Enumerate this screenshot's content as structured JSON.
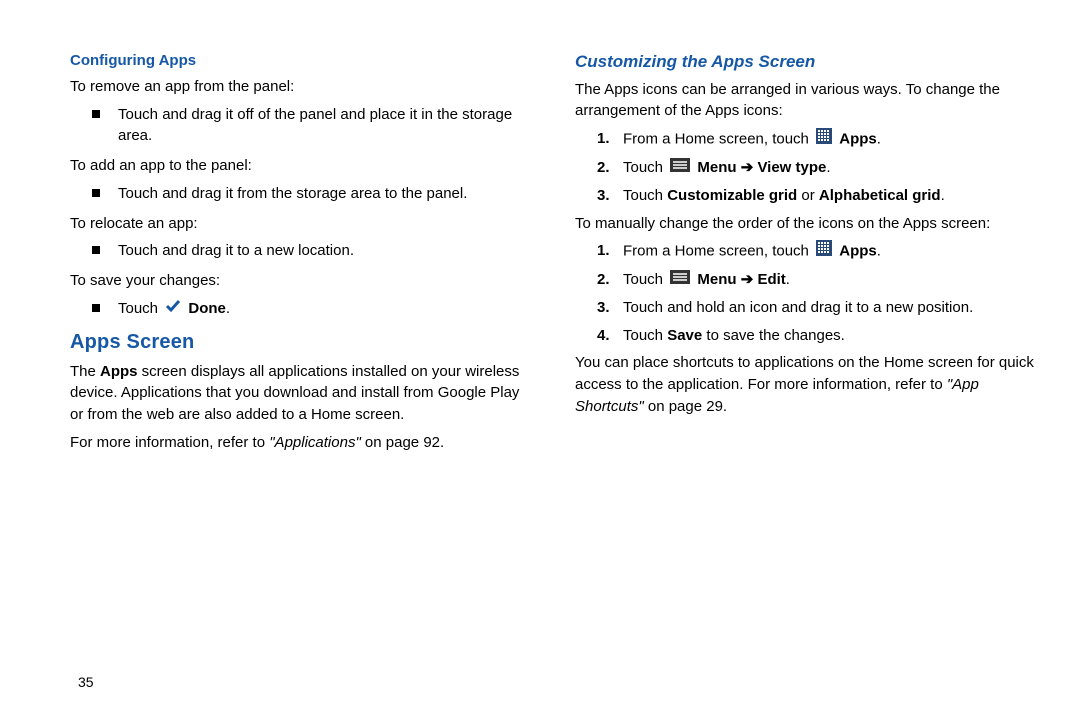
{
  "left": {
    "h1": "Configuring Apps",
    "p_remove": "To remove an app from the panel:",
    "b_remove": "Touch and drag it off of the panel and place it in the storage area.",
    "p_add": "To add an app to the panel:",
    "b_add": "Touch and drag it from the storage area to the panel.",
    "p_reloc": "To relocate an app:",
    "b_reloc": "Touch and drag it to a new location.",
    "p_save": "To save your changes:",
    "b_save_touch": "Touch ",
    "b_save_done": "Done",
    "h2": "Apps Screen",
    "apps_p1_a": "The ",
    "apps_p1_b": "Apps",
    "apps_p1_c": " screen displays all applications installed on your wireless device. Applications that you download and install from Google Play or from the web are also added to a Home screen.",
    "apps_p2_a": "For more information, refer to ",
    "apps_p2_b": "\"Applications\"",
    "apps_p2_c": " on page 92."
  },
  "right": {
    "h1": "Customizing the Apps Screen",
    "p1": "The Apps icons can be arranged in various ways. To change the arrangement of the Apps icons:",
    "o1_a": "From a Home screen, touch ",
    "o1_b": "Apps",
    "o1_c": ".",
    "o2_a": "Touch ",
    "o2_b": "Menu ➔ View type",
    "o2_c": ".",
    "o3_a": "Touch ",
    "o3_b": "Customizable grid",
    "o3_c": " or ",
    "o3_d": "Alphabetical grid",
    "o3_e": ".",
    "p2": "To manually change the order of the icons on the Apps screen:",
    "m1_a": "From a Home screen, touch ",
    "m1_b": "Apps",
    "m1_c": ".",
    "m2_a": "Touch ",
    "m2_b": "Menu ➔ Edit",
    "m2_c": ".",
    "m3": "Touch and hold an icon and drag it to a new position.",
    "m4_a": "Touch ",
    "m4_b": "Save",
    "m4_c": " to save the changes.",
    "p3_a": "You can place shortcuts to applications on the Home screen for quick access to the application. For more information, refer to ",
    "p3_b": "\"App Shortcuts\"",
    "p3_c": " on page 29."
  },
  "pagenum": "35"
}
